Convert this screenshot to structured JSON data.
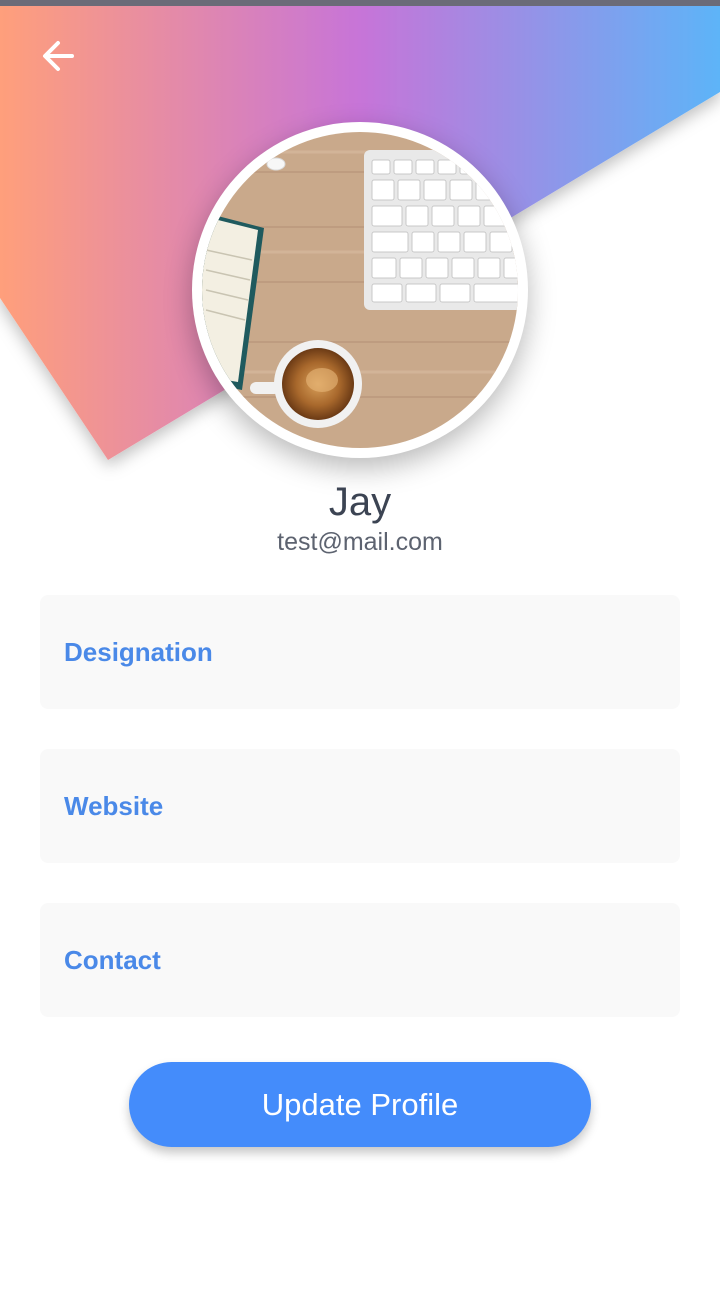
{
  "header": {
    "back_icon": "arrow-left-icon",
    "gradient_colors": [
      "#ff9f7b",
      "#c774d8",
      "#5db4f8"
    ]
  },
  "profile": {
    "name": "Jay",
    "email": "test@mail.com",
    "avatar": "desk-photo-keyboard-coffee-notebook"
  },
  "form": {
    "fields": [
      {
        "label": "Designation"
      },
      {
        "label": "Website"
      },
      {
        "label": "Contact"
      }
    ]
  },
  "actions": {
    "update_label": "Update Profile",
    "accent_color": "#448cfb"
  }
}
